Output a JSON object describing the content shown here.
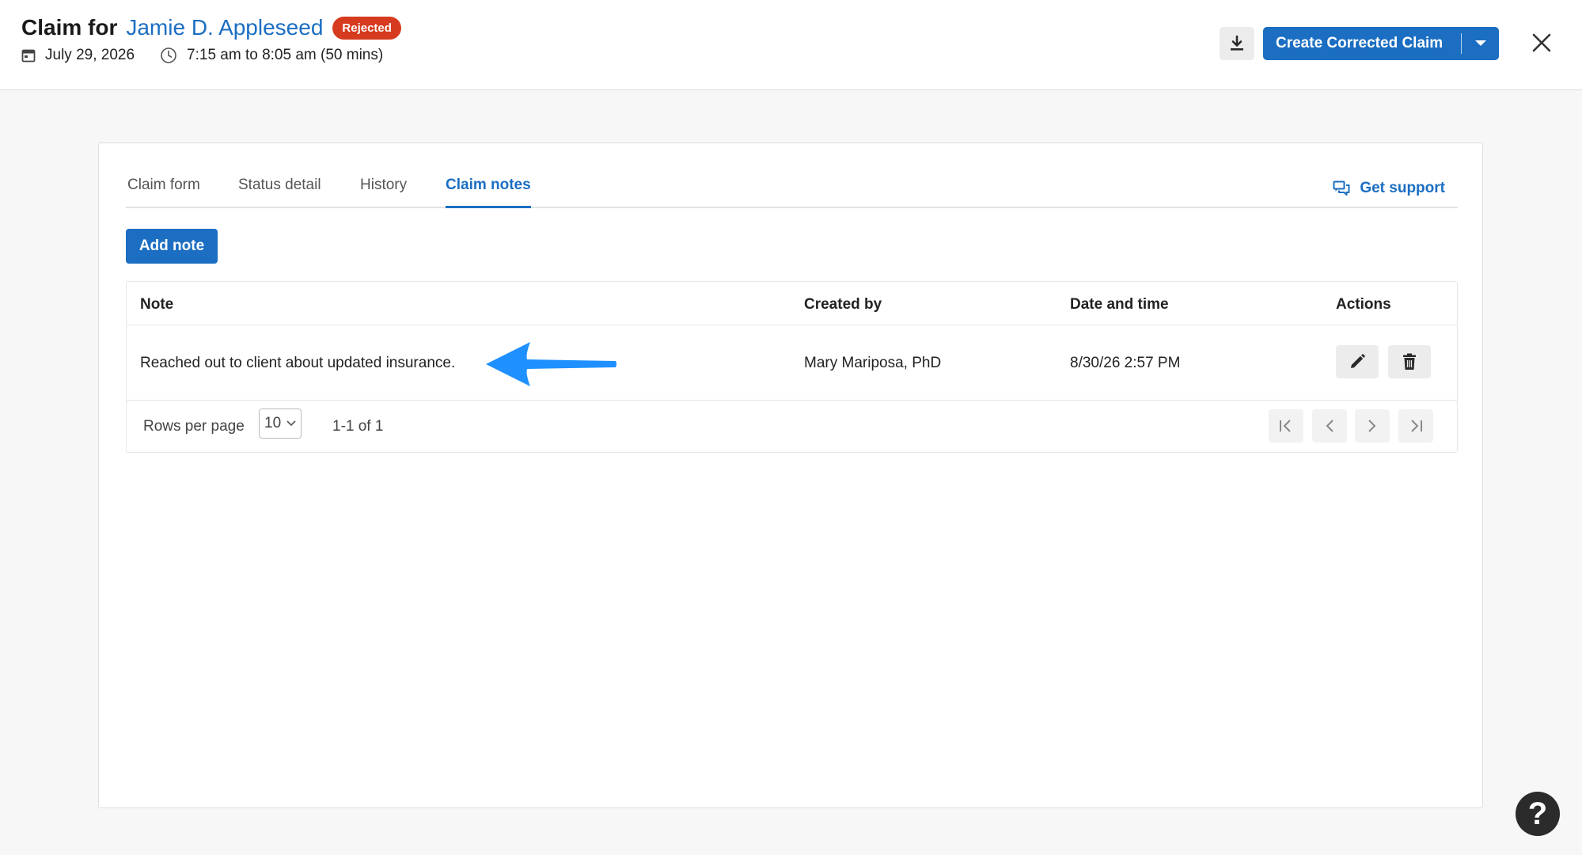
{
  "header": {
    "title_prefix": "Claim for",
    "client_name": "Jamie D. Appleseed",
    "status_badge": "Rejected",
    "date": "July 29, 2026",
    "time_range": "7:15 am to 8:05 am (50 mins)",
    "primary_action_label": "Create Corrected Claim"
  },
  "tabs": [
    {
      "label": "Claim form",
      "active": false
    },
    {
      "label": "Status detail",
      "active": false
    },
    {
      "label": "History",
      "active": false
    },
    {
      "label": "Claim notes",
      "active": true
    }
  ],
  "support_link": "Get support",
  "add_note_label": "Add note",
  "table": {
    "columns": [
      "Note",
      "Created by",
      "Date and time",
      "Actions"
    ],
    "rows": [
      {
        "note": "Reached out to client about updated insurance.",
        "created_by": "Mary Mariposa, PhD",
        "datetime": "8/30/26 2:57 PM"
      }
    ]
  },
  "pagination": {
    "rows_per_page_label": "Rows per page",
    "rows_per_page_value": "10",
    "range_text": "1-1 of 1"
  },
  "help_label": "?",
  "colors": {
    "accent": "#1b6ec2",
    "badge": "#d63a1f",
    "arrow_annotation": "#1e90ff"
  },
  "icons": [
    "calendar-icon",
    "clock-icon",
    "download-icon",
    "caret-down-icon",
    "close-icon",
    "chat-bubbles-icon",
    "pencil-icon",
    "trash-icon",
    "first-page-icon",
    "prev-page-icon",
    "next-page-icon",
    "last-page-icon",
    "help-icon"
  ]
}
